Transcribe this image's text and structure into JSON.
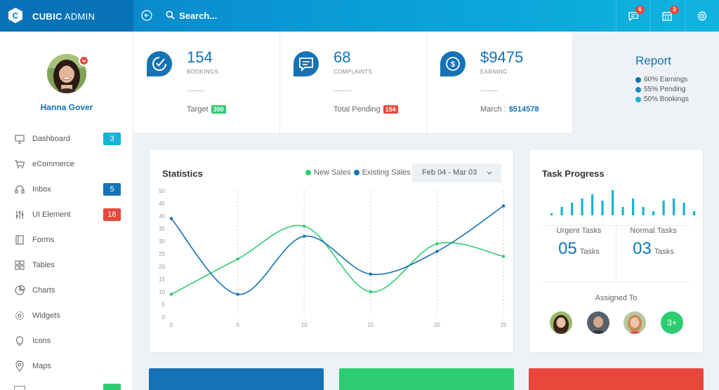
{
  "brand": {
    "bold": "CUBIC",
    "light": "ADMIN"
  },
  "search": {
    "placeholder": "Search..."
  },
  "topbar": {
    "messages_count": "6",
    "calendar_count": "3"
  },
  "user": {
    "name": "Hanna Gover"
  },
  "sidebar": {
    "items": [
      {
        "label": "Dashboard",
        "icon": "monitor-icon",
        "badge": "3",
        "badge_color": "#17b3d6"
      },
      {
        "label": "eCommerce",
        "icon": "cart-icon",
        "badge": ""
      },
      {
        "label": "Inbox",
        "icon": "headset-icon",
        "badge": "5",
        "badge_color": "#1572b5"
      },
      {
        "label": "UI Element",
        "icon": "sliders-icon",
        "badge": "18",
        "badge_color": "#e8473b"
      },
      {
        "label": "Forms",
        "icon": "form-icon",
        "badge": ""
      },
      {
        "label": "Tables",
        "icon": "grid-icon",
        "badge": ""
      },
      {
        "label": "Charts",
        "icon": "pie-chart-icon",
        "badge": ""
      },
      {
        "label": "Widgets",
        "icon": "gear-icon",
        "badge": ""
      },
      {
        "label": "Icons",
        "icon": "lightbulb-icon",
        "badge": ""
      },
      {
        "label": "Maps",
        "icon": "map-pin-icon",
        "badge": ""
      }
    ]
  },
  "stats": [
    {
      "value": "154",
      "label": "BOOKINGS",
      "foot_label": "Target",
      "foot_value": "300",
      "foot_color": "#2ecc71",
      "icon": "check-badge-icon"
    },
    {
      "value": "68",
      "label": "COMPLAINTS",
      "foot_label": "Total Pending",
      "foot_value": "154",
      "foot_color": "#e8473b",
      "icon": "message-icon"
    },
    {
      "value": "$9475",
      "label": "EARNING",
      "foot_label": "March :",
      "foot_value": "$514578",
      "foot_color": "#1572b5",
      "icon": "dollar-icon"
    }
  ],
  "report": {
    "title": "Report",
    "items": [
      {
        "label": "60% Earnings",
        "color": "#1572b5"
      },
      {
        "label": "55% Pending",
        "color": "#1a85c8"
      },
      {
        "label": "50% Bookings",
        "color": "#17b3d6"
      }
    ]
  },
  "statistics": {
    "title": "Statistics",
    "legend_new": "New Sales",
    "legend_existing": "Existing Sales",
    "date_range": "Feb 04 - Mar 03",
    "chart_data": {
      "type": "line",
      "x_ticks": [
        "0",
        "5",
        "10",
        "15",
        "20",
        "25"
      ],
      "y_ticks": [
        "0",
        "5",
        "10",
        "15",
        "20",
        "25",
        "30",
        "35",
        "40",
        "45",
        "50"
      ],
      "ylim": [
        0,
        50
      ],
      "xlim": [
        0,
        25
      ],
      "series": [
        {
          "name": "New Sales",
          "color": "#2ecc71",
          "x": [
            0,
            5,
            10,
            15,
            20,
            25
          ],
          "y": [
            9,
            23,
            36,
            10,
            29,
            24
          ]
        },
        {
          "name": "Existing Sales",
          "color": "#1572b5",
          "x": [
            0,
            5,
            10,
            15,
            20,
            25
          ],
          "y": [
            39,
            9,
            32,
            17,
            26,
            44
          ]
        }
      ]
    }
  },
  "task_progress": {
    "title": "Task Progress",
    "bars": [
      1,
      4,
      6,
      8,
      10,
      7,
      12,
      4,
      8,
      4,
      2,
      7,
      8,
      6,
      2
    ],
    "bar_color": "#17b3d6",
    "urgent_label": "Urgent Tasks",
    "urgent_value": "05",
    "normal_label": "Normal Tasks",
    "normal_value": "03",
    "unit": "Tasks",
    "assigned_label": "Assigned To",
    "more_label": "3+"
  },
  "bottom_cards": [
    {
      "color": "#1572b5"
    },
    {
      "color": "#2ecc71"
    },
    {
      "color": "#e8473b"
    }
  ],
  "sidebar_peek_badge": {
    "color": "#2ecc71"
  }
}
